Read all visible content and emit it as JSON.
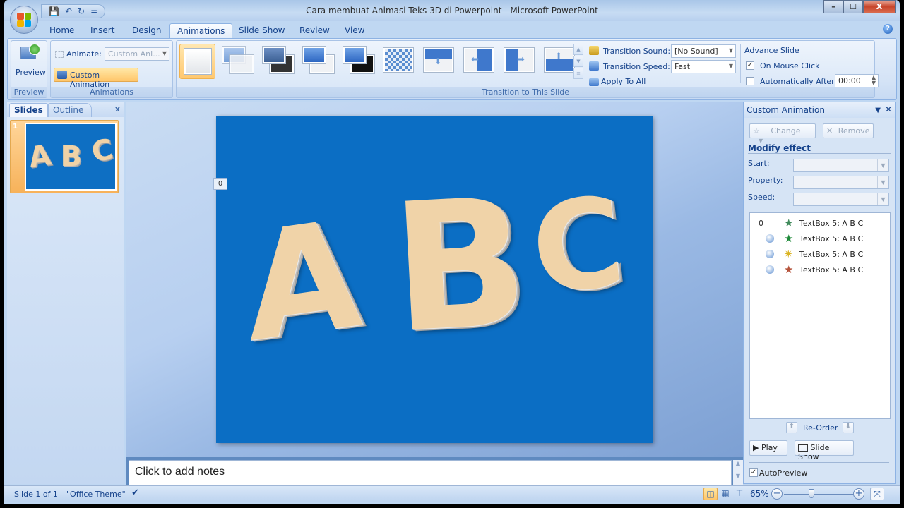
{
  "window": {
    "title": "Cara membuat Animasi Teks 3D di Powerpoint - Microsoft PowerPoint",
    "controls": {
      "minimize": "–",
      "maximize": "☐",
      "close": "X"
    }
  },
  "quick_access": {
    "save": "💾",
    "undo": "↶",
    "redo": "↻",
    "customize": "="
  },
  "ribbon": {
    "tabs": [
      {
        "label": "Home"
      },
      {
        "label": "Insert"
      },
      {
        "label": "Design"
      },
      {
        "label": "Animations",
        "active": true
      },
      {
        "label": "Slide Show"
      },
      {
        "label": "Review"
      },
      {
        "label": "View"
      }
    ],
    "help": "?",
    "preview_group": {
      "button_label": "Preview",
      "group_label": "Preview"
    },
    "animations_group": {
      "animate_label": "Animate:",
      "animate_value": "Custom Ani...",
      "custom_animation_label": "Custom Animation",
      "group_label": "Animations"
    },
    "transition_group": {
      "group_label": "Transition to This Slide",
      "gallery": [
        {
          "name": "no-transition",
          "selected": true
        },
        {
          "name": "fade-smoothly"
        },
        {
          "name": "fade-through-black"
        },
        {
          "name": "cut"
        },
        {
          "name": "cut-through-black"
        },
        {
          "name": "dissolve"
        },
        {
          "name": "wipe-down"
        },
        {
          "name": "wipe-left"
        },
        {
          "name": "wipe-right"
        },
        {
          "name": "wipe-up"
        }
      ],
      "sound_label": "Transition Sound:",
      "sound_value": "[No Sound]",
      "speed_label": "Transition Speed:",
      "speed_value": "Fast",
      "apply_all_label": "Apply To All"
    },
    "advance_group": {
      "title": "Advance Slide",
      "on_mouse_click_label": "On Mouse Click",
      "on_mouse_click_checked": true,
      "auto_after_label": "Automatically After:",
      "auto_after_checked": false,
      "auto_after_value": "00:00"
    }
  },
  "left_pane": {
    "tabs": [
      {
        "label": "Slides",
        "active": true
      },
      {
        "label": "Outline"
      }
    ],
    "close": "x",
    "slides": [
      {
        "number": "1",
        "letters": [
          "A",
          "B",
          "C"
        ]
      }
    ]
  },
  "slide": {
    "letters": [
      "A",
      "B",
      "C"
    ],
    "animation_tag": "0",
    "background": "#0b6ec4"
  },
  "notes": {
    "placeholder": "Click to add notes"
  },
  "task_pane": {
    "title": "Custom Animation",
    "menu": "▼",
    "close": "✕",
    "change_label": "Change",
    "remove_label": "Remove",
    "modify_title": "Modify effect",
    "start_label": "Start:",
    "property_label": "Property:",
    "speed_label": "Speed:",
    "animations": [
      {
        "order": "0",
        "trigger": "",
        "effect_icon": "entrance-star-icon",
        "color": "#3f8a5a",
        "label": "TextBox 5: A B C"
      },
      {
        "order": "",
        "trigger": "clock-icon",
        "effect_icon": "emphasis-star-icon",
        "color": "#1f8a3a",
        "label": "TextBox 5: A B C"
      },
      {
        "order": "",
        "trigger": "clock-icon",
        "effect_icon": "emphasis-sparkle-icon",
        "color": "#d9b21f",
        "label": "TextBox 5: A B C"
      },
      {
        "order": "",
        "trigger": "clock-icon",
        "effect_icon": "exit-star-icon",
        "color": "#b5533b",
        "label": "TextBox 5: A B C"
      }
    ],
    "reorder_label": "Re-Order",
    "play_label": "Play",
    "slideshow_label": "Slide Show",
    "autopreview_label": "AutoPreview",
    "autopreview_checked": true
  },
  "status_bar": {
    "slide_info": "Slide 1 of 1",
    "theme": "\"Office Theme\"",
    "zoom_level": "65%",
    "zoom_fraction": 0.4
  }
}
